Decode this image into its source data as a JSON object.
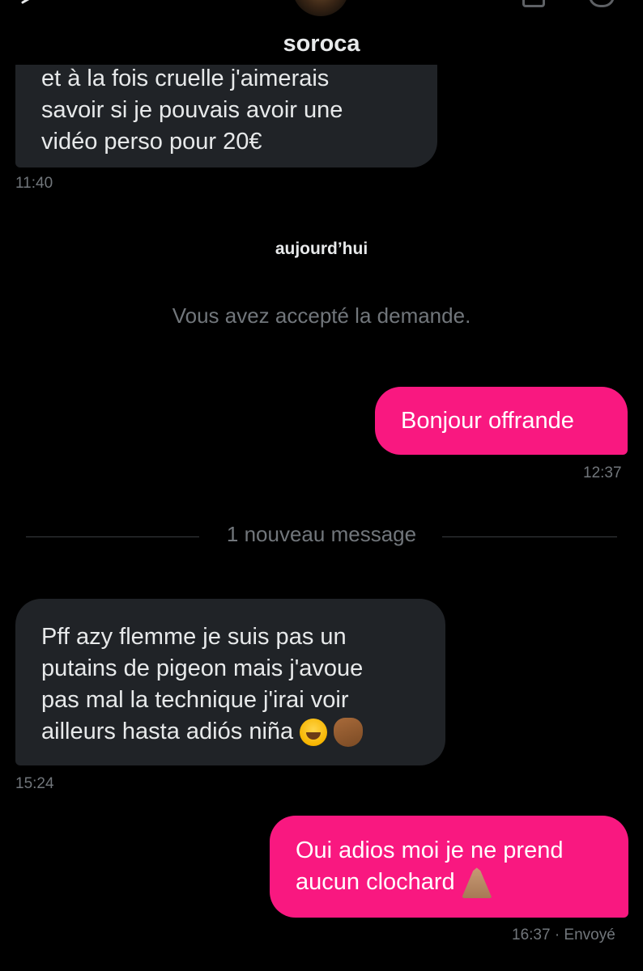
{
  "header": {
    "title": "soroca",
    "back_icon": "back-arrow-icon",
    "avatar_icon": "avatar"
  },
  "messages": {
    "first_received": {
      "lines": [
        "et à la fois cruelle j'aimerais",
        "savoir si je pouvais avoir une",
        "vidéo perso pour 20€"
      ],
      "time": "11:40"
    },
    "day_separator": "aujourd’hui",
    "system_message": "Vous avez accepté la demande.",
    "sent_1": {
      "text": "Bonjour offrande",
      "time": "12:37"
    },
    "new_message_divider": "1 nouveau message",
    "received_2": {
      "lines": [
        "Pff azy flemme  je suis pas un",
        "putains de pigeon mais j'avoue",
        "pas mal la technique j'irai voir",
        "ailleurs   hasta adiós niña"
      ],
      "emojis": [
        "face-with-tears-of-joy-emoji",
        "waving-hand-emoji"
      ],
      "time": "15:24"
    },
    "sent_2": {
      "lines": [
        "Oui adios moi je ne prend",
        "aucun clochard"
      ],
      "emoji": "folded-hands-emoji",
      "time": "16:37",
      "status": "· Envoyé"
    }
  },
  "colors": {
    "background": "#000000",
    "received_bubble": "#202327",
    "sent_bubble": "#f91880",
    "secondary_text": "#71767b"
  }
}
